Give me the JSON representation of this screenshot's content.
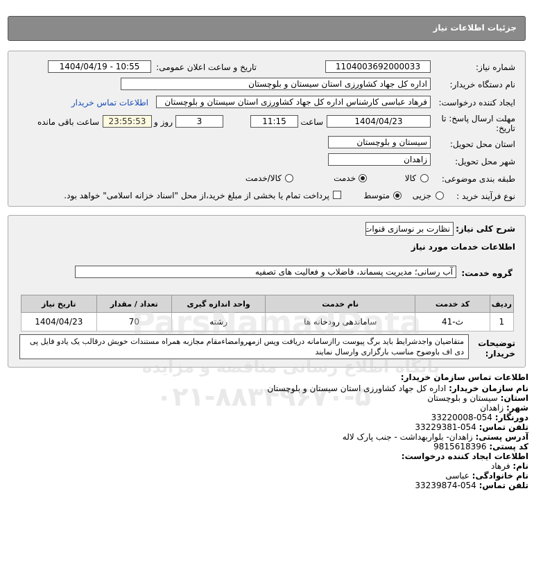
{
  "header": {
    "title": "جزئیات اطلاعات نیاز"
  },
  "need": {
    "number_label": "شماره نیاز:",
    "number_value": "1104003692000033",
    "announce_label": "تاریخ و ساعت اعلان عمومی:",
    "announce_value": "1404/04/19 - 10:55",
    "buyer_label": "نام دستگاه خریدار:",
    "buyer_value": "اداره کل جهاد کشاورزی استان سیستان و بلوچستان",
    "creator_label": "ایجاد کننده درخواست:",
    "creator_value": "فرهاد عباسی کارشناس  اداره کل جهاد کشاورزی استان سیستان و بلوچستان",
    "contact_link": "اطلاعات تماس خریدار",
    "deadline_label_1": "مهلت ارسال پاسخ: تا",
    "deadline_label_2": "تاریخ:",
    "deadline_date": "1404/04/23",
    "time_label": "ساعت",
    "deadline_time": "11:15",
    "days_value": "3",
    "days_label": "روز و",
    "remaining_value": "23:55:53",
    "remaining_label": "ساعت باقی مانده",
    "province_label": "استان محل تحویل:",
    "province_value": "سیستان و بلوچستان",
    "city_label": "شهر محل تحویل:",
    "city_value": "زاهدان",
    "category_label": "طبقه بندی موضوعی:",
    "category_options": [
      "کالا",
      "خدمت",
      "کالا/خدمت"
    ],
    "category_selected": "خدمت",
    "process_label": "نوع فرآیند خرید :",
    "process_options": [
      "جزیی",
      "متوسط"
    ],
    "process_selected": "متوسط",
    "payment_text": "پرداخت تمام یا بخشی از مبلغ خرید،از محل \"اسناد خزانه اسلامی\" خواهد بود."
  },
  "summary": {
    "desc_label": "شرح کلی نیاز:",
    "desc_value": "نظارت بر نوسازی قنوات",
    "services_heading": "اطلاعات خدمات مورد نیاز",
    "group_label": "گروه خدمت:",
    "group_value": "آب رسانی؛ مدیریت پسماند، فاضلاب و فعالیت های تصفیه",
    "table": {
      "headers": [
        "ردیف",
        "کد خدمت",
        "نام خدمت",
        "واحد اندازه گیری",
        "تعداد / مقدار",
        "تاریخ نیاز"
      ],
      "rows": [
        [
          "1",
          "ث-41",
          "ساماندهی رودخانه ها",
          "رشته",
          "70",
          "1404/04/23"
        ]
      ]
    },
    "notes_label_1": "توضیحات",
    "notes_label_2": "خریدار:",
    "notes_value": "متقاضیان واجدشرایط باید برگ پیوست راازسامانه دریافت وپس ازمهروامضاءمقام مجازبه همراه مستندات خویش درقالب یک یادو فایل پی دی اف باوضوح مناسب بارگزاری وارسال نمایند"
  },
  "contact": {
    "title": "اطلاعات تماس سازمان خریدار:",
    "org_label": "نام سازمان خریدار:",
    "org_value": "اداره کل جهاد کشاورزی استان سیستان و بلوچستان",
    "province_label": "استان:",
    "province_value": "سیستان و بلوچستان",
    "city_label": "شهر:",
    "city_value": "زاهدان",
    "fax_label": "دورنگار:",
    "fax_value": "054-33220008",
    "phone_label": "تلفن تماس:",
    "phone_value": "054-33229381",
    "address_label": "آدرس پستی:",
    "address_value": "زاهدان- بلواربهداشت - جنب پارک لاله",
    "postal_label": "کد پستی:",
    "postal_value": "9815618396",
    "creator_title": "اطلاعات ایجاد کننده درخواست:",
    "name_label": "نام:",
    "name_value": "فرهاد",
    "family_label": "نام خانوادگی:",
    "family_value": "عباسی",
    "creator_phone_label": "تلفن تماس:",
    "creator_phone_value": "054-33239874"
  },
  "watermark": {
    "brand": "ParsNamadData",
    "line1": "پایگاه اطلاع رسانی مناقصه و مزایده",
    "phone": "۰۲۱-۸۸۳۴۹۶۷۰-۵"
  }
}
